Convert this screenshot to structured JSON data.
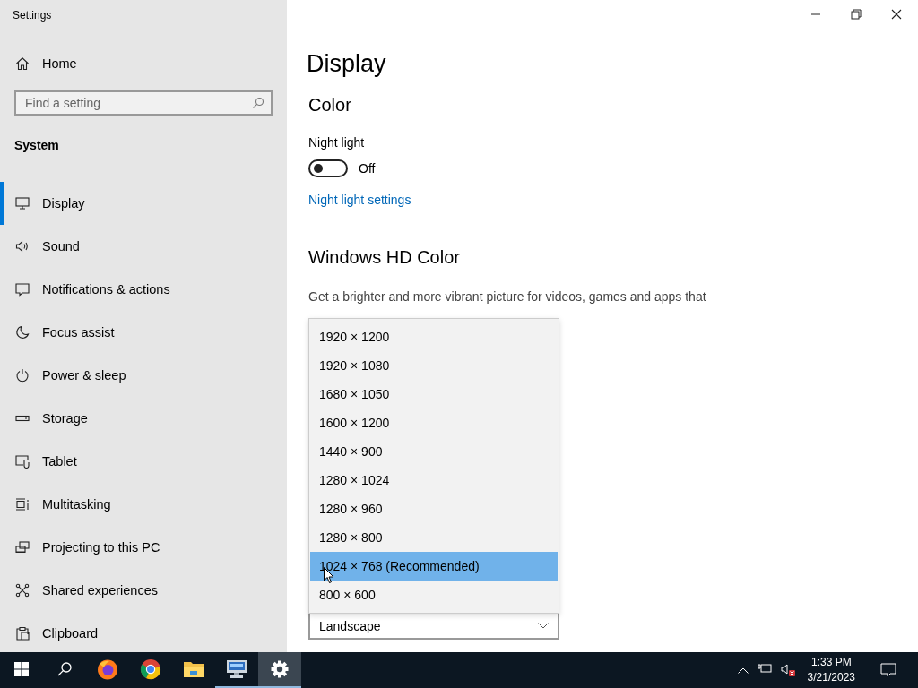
{
  "window": {
    "title": "Settings"
  },
  "sidebar": {
    "home": "Home",
    "search": {
      "placeholder": "Find a setting"
    },
    "section": "System",
    "items": [
      {
        "label": "Display",
        "selected": true
      },
      {
        "label": "Sound",
        "selected": false
      },
      {
        "label": "Notifications & actions",
        "selected": false
      },
      {
        "label": "Focus assist",
        "selected": false
      },
      {
        "label": "Power & sleep",
        "selected": false
      },
      {
        "label": "Storage",
        "selected": false
      },
      {
        "label": "Tablet",
        "selected": false
      },
      {
        "label": "Multitasking",
        "selected": false
      },
      {
        "label": "Projecting to this PC",
        "selected": false
      },
      {
        "label": "Shared experiences",
        "selected": false
      },
      {
        "label": "Clipboard",
        "selected": false
      }
    ]
  },
  "content": {
    "title": "Display",
    "color_heading": "Color",
    "night_light": {
      "label": "Night light",
      "on": false,
      "state_text": "Off"
    },
    "night_light_link": "Night light settings",
    "hd_heading": "Windows HD Color",
    "hd_description": "Get a brighter and more vibrant picture for videos, games and apps that",
    "resolution_menu": {
      "options": [
        {
          "label": "1920 × 1200",
          "selected": false
        },
        {
          "label": "1920 × 1080",
          "selected": false
        },
        {
          "label": "1680 × 1050",
          "selected": false
        },
        {
          "label": "1600 × 1200",
          "selected": false
        },
        {
          "label": "1440 × 900",
          "selected": false
        },
        {
          "label": "1280 × 1024",
          "selected": false
        },
        {
          "label": "1280 × 960",
          "selected": false
        },
        {
          "label": "1280 × 800",
          "selected": false
        },
        {
          "label": "1024 × 768 (Recommended)",
          "selected": true
        },
        {
          "label": "800 × 600",
          "selected": false
        }
      ]
    },
    "orientation": {
      "value": "Landscape"
    }
  },
  "taskbar": {
    "apps": [
      {
        "running": false,
        "selected": false
      },
      {
        "running": false,
        "selected": false
      },
      {
        "running": false,
        "selected": false
      },
      {
        "running": true,
        "selected": false
      },
      {
        "running": true,
        "selected": true
      }
    ],
    "time": "1:33 PM",
    "date": "3/21/2023"
  }
}
